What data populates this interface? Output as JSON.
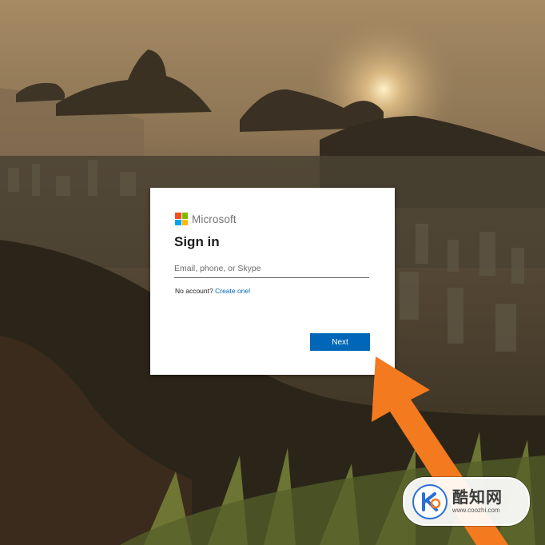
{
  "signin": {
    "brand": "Microsoft",
    "title": "Sign in",
    "input_placeholder": "Email, phone, or Skype",
    "input_value": "",
    "no_account_text": "No account?",
    "create_link": "Create one!",
    "next_label": "Next"
  },
  "colors": {
    "logo_red": "#f25022",
    "logo_green": "#7fba00",
    "logo_blue": "#00a4ef",
    "logo_yellow": "#ffb900",
    "button_blue": "#0067b8",
    "arrow_orange": "#f47a20"
  },
  "watermark": {
    "name": "酷知网",
    "url": "www.coozhi.com"
  }
}
